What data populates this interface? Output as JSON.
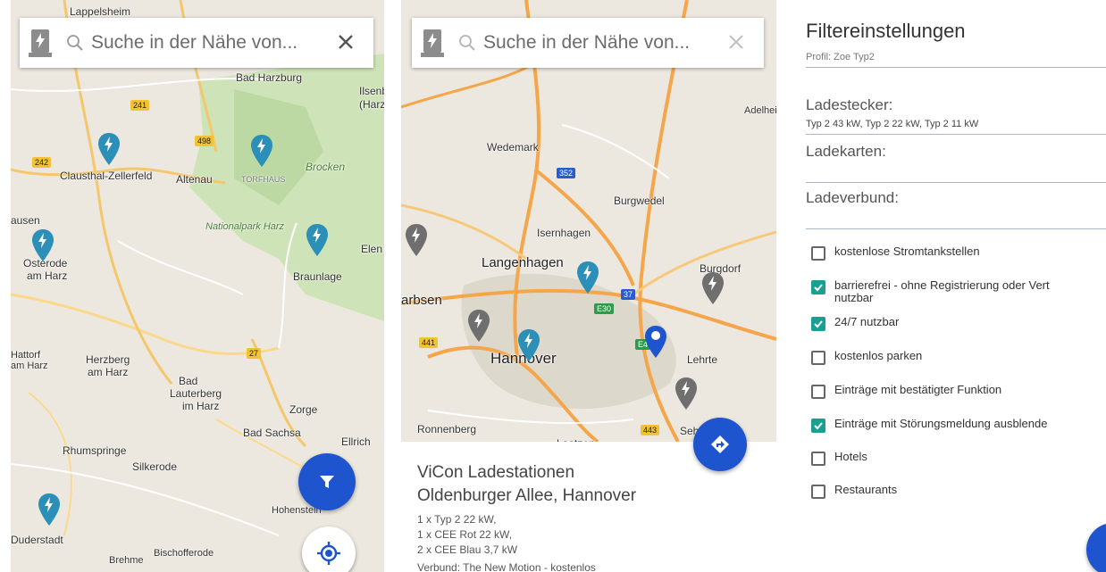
{
  "screen1": {
    "search": {
      "placeholder": "Suche in der Nähe von..."
    },
    "map_labels": [
      "Lappelsheim",
      "Bad Harzburg",
      "Ilsenb",
      "(Harz",
      "Clausthal-Zellerfeld",
      "Altenau",
      "Brocken",
      "TORFHAUS",
      "Nationalpark Harz",
      "ausen",
      "Osterode",
      "am Harz",
      "Braunlage",
      "Elen",
      "Hattorf",
      "am Harz",
      "Herzberg",
      "am Harz",
      "Bad",
      "Lauterberg",
      "im Harz",
      "Zorge",
      "Bad Sachsa",
      "Ellrich",
      "Rhumspringe",
      "Silkerode",
      "Hohenstein",
      "Duderstadt",
      "Brehme",
      "Bischofferode"
    ],
    "road_shields": [
      "241",
      "498",
      "242",
      "27"
    ],
    "fab_filter_icon": "filter-icon",
    "fab_location_icon": "my-location-icon",
    "colors": {
      "accent": "#1e55cf",
      "pin": "#2b8fb8",
      "park": "#cfe3b8"
    }
  },
  "screen2": {
    "search": {
      "placeholder": "Suche in der Nähe von..."
    },
    "map_labels": [
      "Wedemark",
      "Burgwedel",
      "Isernhagen",
      "Adelhei",
      "Langenhagen",
      "arbsen",
      "Burgdorf",
      "Hannover",
      "Lehrte",
      "Ronnenberg",
      "Laatzen",
      "Seh"
    ],
    "road_shields": [
      "352",
      "37",
      "E30",
      "441",
      "443",
      "E4"
    ],
    "fab_directions_icon": "directions-icon",
    "card": {
      "title": "ViCon Ladestationen",
      "address": "Oldenburger Allee, Hannover",
      "lines": [
        "1 x Typ 2 22 kW,",
        "1 x CEE Rot 22 kW,",
        "2 x CEE Blau 3,7 kW",
        "Verbund: The New Motion - kostenlos"
      ]
    }
  },
  "screen3": {
    "title": "Filtereinstellungen",
    "profile": "Profil: Zoe Typ2",
    "ladestecker": {
      "label": "Ladestecker:",
      "value": "Typ 2 43 kW, Typ 2 22 kW, Typ 2 11 kW"
    },
    "ladekarten": {
      "label": "Ladekarten:"
    },
    "ladeverbund": {
      "label": "Ladeverbund:"
    },
    "checkboxes": [
      {
        "label": "kostenlose Stromtankstellen",
        "checked": false
      },
      {
        "label": "barrierefrei - ohne Registrierung oder Vert",
        "label2": "nutzbar",
        "checked": true
      },
      {
        "label": "24/7 nutzbar",
        "checked": true
      },
      {
        "label": "kostenlos parken",
        "checked": false
      },
      {
        "label": "Einträge mit bestätigter Funktion",
        "checked": false
      },
      {
        "label": "Einträge mit Störungsmeldung ausblende",
        "checked": true
      },
      {
        "label": "Hotels",
        "checked": false
      },
      {
        "label": "Restaurants",
        "checked": false
      }
    ],
    "colors": {
      "checkbox_on": "#1aa093"
    }
  }
}
